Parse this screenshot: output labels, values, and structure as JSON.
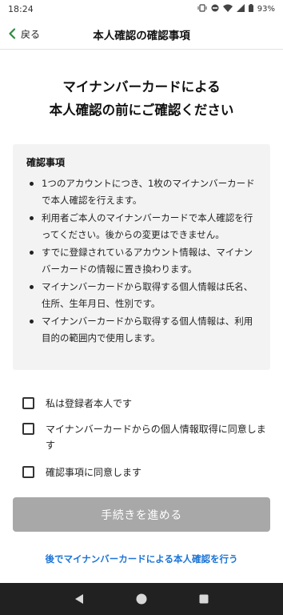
{
  "status_bar": {
    "time": "18:24",
    "battery": "93%"
  },
  "header": {
    "back_label": "戻る",
    "title": "本人確認の確認事項"
  },
  "headline": {
    "line1": "マイナンバーカードによる",
    "line2": "本人確認の前にご確認ください"
  },
  "notice": {
    "title": "確認事項",
    "items": [
      "1つのアカウントにつき、1枚のマイナンバーカードで本人確認を行えます。",
      "利用者ご本人のマイナンバーカードで本人確認を行ってください。後からの変更はできません。",
      "すでに登録されているアカウント情報は、マイナンバーカードの情報に置き換わります。",
      "マイナンバーカードから取得する個人情報は氏名、住所、生年月日、性別です。",
      "マイナンバーカードから取得する個人情報は、利用目的の範囲内で使用します。"
    ]
  },
  "checks": [
    {
      "label": "私は登録者本人です",
      "checked": false
    },
    {
      "label": "マイナンバーカードからの個人情報取得に同意します",
      "checked": false
    },
    {
      "label": "確認事項に同意します",
      "checked": false
    }
  ],
  "proceed_button": {
    "label": "手続きを進める",
    "enabled": false
  },
  "later_link": {
    "label": "後でマイナンバーカードによる本人確認を行う"
  },
  "colors": {
    "accent_green": "#2e8b3d",
    "link_blue": "#1b74d6",
    "disabled_button": "#a8a8a8",
    "nav_bar": "#212121"
  }
}
